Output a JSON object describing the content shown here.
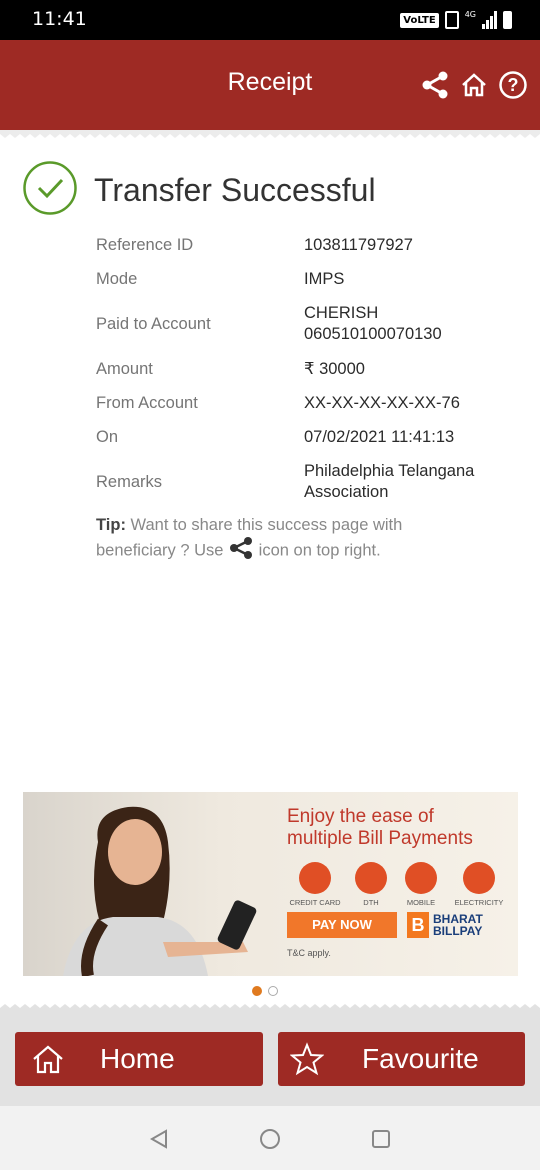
{
  "status_bar": {
    "time": "11:41",
    "network": "VoLTE",
    "network_type": "4G"
  },
  "header": {
    "title": "Receipt",
    "icons": [
      "share-icon",
      "home-icon",
      "help-icon"
    ]
  },
  "success": {
    "title": "Transfer Successful",
    "icon": "check-circle-icon"
  },
  "details": [
    {
      "label": "Reference ID",
      "value": "103811797927"
    },
    {
      "label": "Mode",
      "value": "IMPS"
    },
    {
      "label": "Paid to Account",
      "value": "CHERISH 060510100070130"
    },
    {
      "label": "Amount",
      "value": "₹ 30000"
    },
    {
      "label": "From Account",
      "value": "XX-XX-XX-XX-XX-76"
    },
    {
      "label": "On",
      "value": "07/02/2021 11:41:13"
    },
    {
      "label": "Remarks",
      "value": "Philadelphia Telangana Association"
    }
  ],
  "tip": {
    "prefix": "Tip:",
    "text_before": "Want to share this success page with beneficiary ? Use",
    "text_after": "icon on top right."
  },
  "banner": {
    "headline_line1": "Enjoy the ease of",
    "headline_line2": "multiple Bill Payments",
    "categories": [
      "CREDIT CARD",
      "DTH",
      "MOBILE",
      "ELECTRICITY"
    ],
    "cta": "PAY NOW",
    "brand_line1": "BHARAT",
    "brand_line2": "BILLPAY",
    "terms": "T&C apply."
  },
  "carousel": {
    "count": 2,
    "active": 0
  },
  "buttons": {
    "home": "Home",
    "favourite": "Favourite"
  },
  "colors": {
    "brand": "#9e2a24",
    "success_green": "#5a9a2a",
    "active_dot": "#e07a1f"
  }
}
